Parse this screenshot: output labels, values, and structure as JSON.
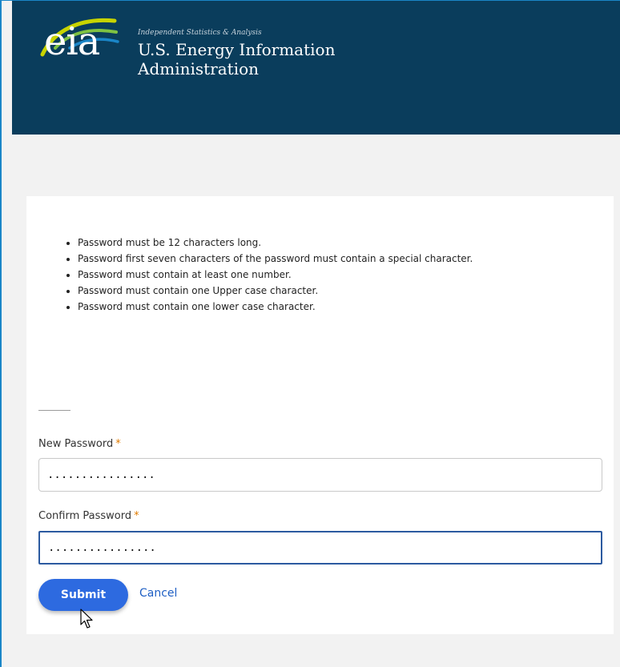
{
  "header": {
    "logo_text": "eia",
    "tagline": "Independent Statistics & Analysis",
    "org_name": "U.S. Energy Information Administration"
  },
  "requirements": [
    "Password must be 12 characters long.",
    "Password first seven characters of the password must contain a special character.",
    "Password must contain at least one number.",
    "Password must contain one Upper case character.",
    "Password must contain one lower case character."
  ],
  "form": {
    "new_password": {
      "label": "New Password",
      "required_mark": "*",
      "value": "................"
    },
    "confirm_password": {
      "label": "Confirm Password",
      "required_mark": "*",
      "value": "................"
    },
    "submit_label": "Submit",
    "cancel_label": "Cancel"
  },
  "colors": {
    "header_bg": "#0a3d5c",
    "accent": "#2d6ae0",
    "required": "#e07b00",
    "link": "#1f5fc4"
  },
  "icons": [
    "eia-logo-icon",
    "mouse-pointer-icon"
  ]
}
